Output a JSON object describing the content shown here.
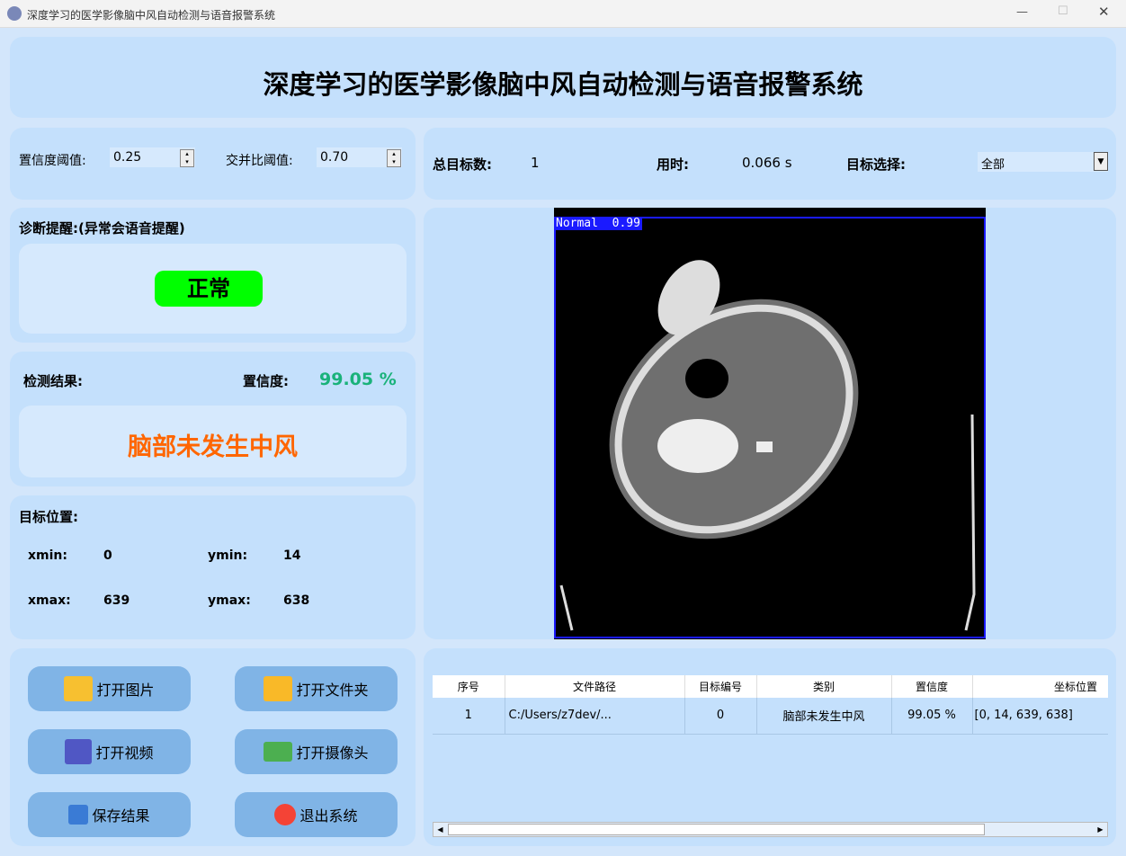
{
  "window": {
    "title": "深度学习的医学影像脑中风自动检测与语音报警系统"
  },
  "header": {
    "title": "深度学习的医学影像脑中风自动检测与语音报警系统"
  },
  "params": {
    "conf_label": "置信度阈值:",
    "conf_value": "0.25",
    "iou_label": "交并比阈值:",
    "iou_value": "0.70"
  },
  "stats": {
    "total_label": "总目标数:",
    "total_value": "1",
    "time_label": "用时:",
    "time_value": "0.066 s",
    "select_label": "目标选择:",
    "select_value": "全部"
  },
  "diagnosis": {
    "title": "诊断提醒:(异常会语音提醒)",
    "status": "正常",
    "status_color": "#00ff00"
  },
  "result": {
    "title": "检测结果:",
    "conf_label": "置信度:",
    "conf_value": "99.05 %",
    "text": "脑部未发生中风",
    "text_color": "#ff6600"
  },
  "position": {
    "title": "目标位置:",
    "xmin_label": "xmin:",
    "xmin": "0",
    "ymin_label": "ymin:",
    "ymin": "14",
    "xmax_label": "xmax:",
    "xmax": "639",
    "ymax_label": "ymax:",
    "ymax": "638"
  },
  "image": {
    "box_label": "Normal  0.99"
  },
  "buttons": {
    "open_image": "打开图片",
    "open_folder": "打开文件夹",
    "open_video": "打开视频",
    "open_camera": "打开摄像头",
    "save": "保存结果",
    "exit": "退出系统"
  },
  "table": {
    "headers": [
      "序号",
      "文件路径",
      "目标编号",
      "类别",
      "置信度",
      "坐标位置"
    ],
    "rows": [
      [
        "1",
        "C:/Users/z7dev/...",
        "0",
        "脑部未发生中风",
        "99.05 %",
        "[0, 14, 639, 638]"
      ]
    ]
  }
}
